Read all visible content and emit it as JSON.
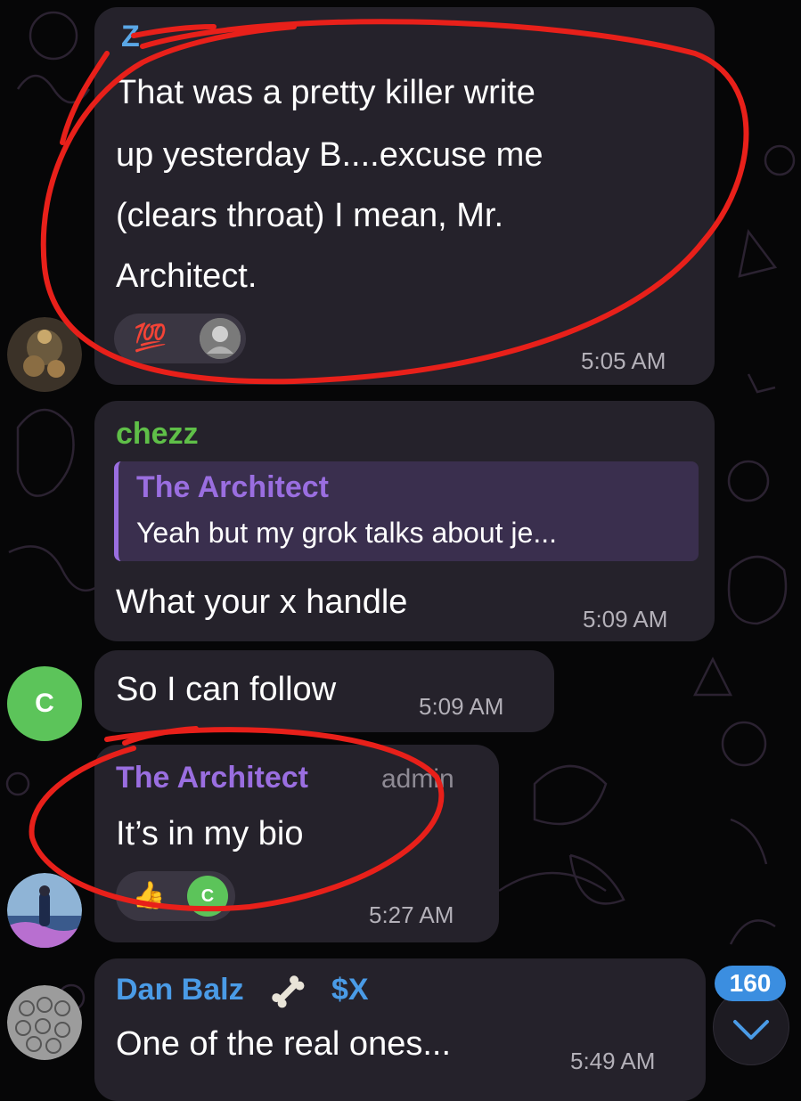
{
  "messages": [
    {
      "sender": "Z",
      "text_lines": [
        "That was a pretty killer write",
        "up yesterday B....excuse me",
        "(clears throat) I mean, Mr.",
        "Architect."
      ],
      "reactions": {
        "emoji": "💯"
      },
      "time": "5:05 AM"
    },
    {
      "sender": "chezz",
      "reply": {
        "author": "The Architect",
        "snippet": "Yeah but my grok talks about je..."
      },
      "text": "What your x handle",
      "time": "5:09 AM"
    },
    {
      "avatar_letter": "C",
      "text": "So I can follow",
      "time": "5:09 AM"
    },
    {
      "sender": "The Architect",
      "role": "admin",
      "text": "It’s in my bio",
      "reactions": {
        "emoji": "👍",
        "avatar_letter": "C"
      },
      "time": "5:27 AM"
    },
    {
      "sender": "Dan Balz",
      "sender_icon": "bone-icon",
      "sender_suffix": "$X",
      "text": "One of the real ones...",
      "time": "5:49 AM"
    }
  ],
  "scroll": {
    "unread_count": "160"
  },
  "colors": {
    "bubble": "#25222b",
    "z_name": "#5aa7e6",
    "chezz_name": "#5fbf48",
    "architect_name": "#9a6ee0",
    "dan_name": "#4a9be6",
    "annotation": "#e8201a"
  }
}
